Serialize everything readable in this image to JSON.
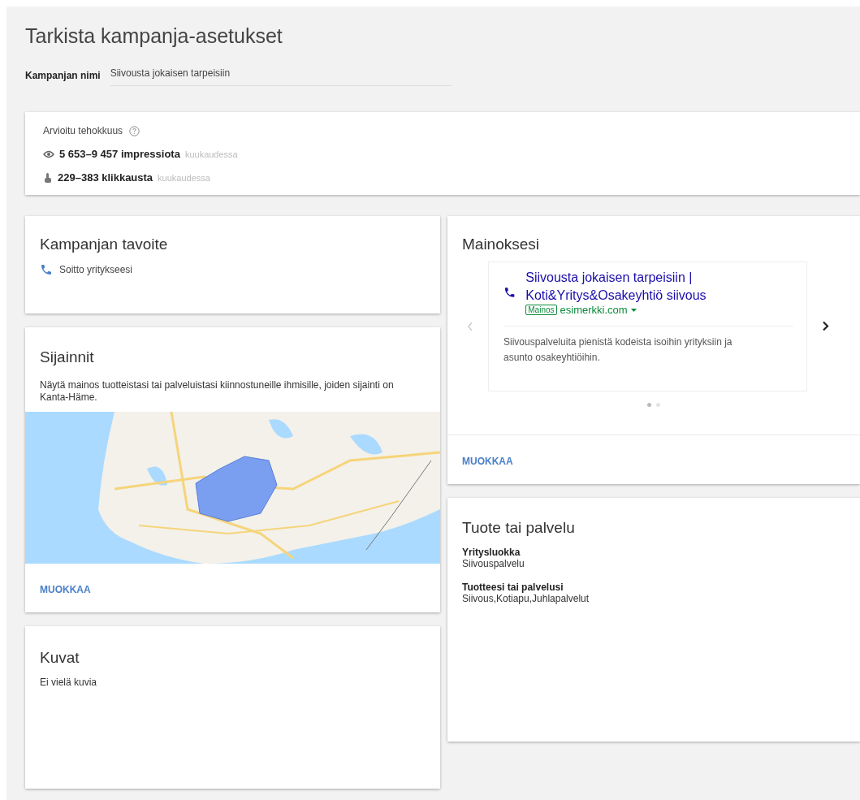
{
  "page_title": "Tarkista kampanja-asetukset",
  "campaign_name": {
    "label": "Kampanjan nimi",
    "value": "Siivousta jokaisen tarpeisiin"
  },
  "performance": {
    "title": "Arvioitu tehokkuus",
    "metrics": [
      {
        "kind": "impressions",
        "value": "5 653–9 457 impressiota",
        "period": "kuukaudessa"
      },
      {
        "kind": "clicks",
        "value": "229–383 klikkausta",
        "period": "kuukaudessa"
      }
    ]
  },
  "goal": {
    "title": "Kampanjan tavoite",
    "value": "Soitto yritykseesi"
  },
  "locations": {
    "title": "Sijainnit",
    "description": "Näytä mainos tuotteistasi tai palveluistasi kiinnostuneille ihmisille, joiden sijainti on Kanta-Häme.",
    "action": "MUOKKAA"
  },
  "images": {
    "title": "Kuvat",
    "value": "Ei vielä kuvia"
  },
  "ads": {
    "title": "Mainoksesi",
    "ad": {
      "headline": "Siivousta jokaisen tarpeisiin | Koti&Yritys&Osakeyhtiö siivous",
      "badge": "Mainos",
      "url": "esimerkki.com",
      "description": "Siivouspalveluita pienistä kodeista isoihin yrityksiin ja asunto osakeyhtiöihin."
    },
    "prev_disabled": true,
    "dots": [
      {
        "selected": true
      },
      {
        "selected": false
      }
    ],
    "action": "MUOKKAA"
  },
  "product": {
    "title": "Tuote tai palvelu",
    "fields": [
      {
        "label": "Yritysluokka",
        "value": "Siivouspalvelu"
      },
      {
        "label": "Tuotteesi tai palvelusi",
        "value": "Siivous,Kotiapu,Juhlapalvelut"
      }
    ]
  }
}
